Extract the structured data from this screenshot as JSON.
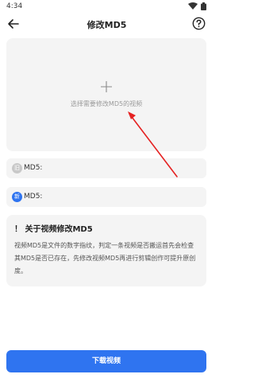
{
  "status_bar": {
    "time": "4:34"
  },
  "app_bar": {
    "title": "修改MD5"
  },
  "picker": {
    "hint": "选择需要修改MD5的视频"
  },
  "md5_rows": [
    {
      "badge": "旧",
      "label": "MD5:"
    },
    {
      "badge": "新",
      "label": "MD5:"
    }
  ],
  "info": {
    "title": "！ 关于视频修改MD5",
    "body": "视频MD5是文件的数字指纹，判定一条视频是否搬运首先会检查其MD5是否已存在，先修改视频MD5再进行剪辑创作可提升原创度。"
  },
  "download": {
    "label": "下载视频"
  },
  "colors": {
    "accent": "#2f74f0",
    "arrow": "#e52222",
    "card_bg": "#f4f4f4"
  }
}
